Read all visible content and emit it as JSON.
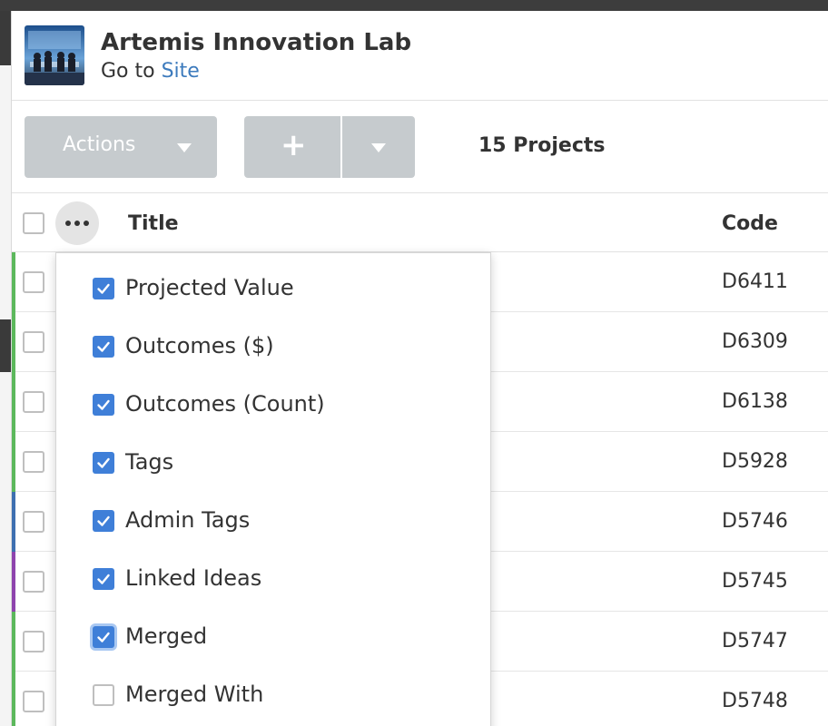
{
  "site": {
    "name": "Artemis Innovation Lab",
    "goto_prefix": "Go to",
    "goto_link": "Site"
  },
  "toolbar": {
    "actions_label": "Actions",
    "add_label": "+",
    "projects_count": "15 Projects"
  },
  "table": {
    "headers": {
      "title": "Title",
      "code": "Code"
    },
    "rows": [
      {
        "code": "D6411",
        "color": "#5cb85c"
      },
      {
        "code": "D6309",
        "color": "#5cb85c"
      },
      {
        "code": "D6138",
        "color": "#5cb85c"
      },
      {
        "code": "D5928",
        "color": "#5cb85c"
      },
      {
        "code": "D5746",
        "color": "#3e6fb0"
      },
      {
        "code": "D5745",
        "color": "#8e44ad"
      },
      {
        "code": "D5747",
        "color": "#5cb85c"
      },
      {
        "code": "D5748",
        "color": "#5cb85c"
      }
    ]
  },
  "column_menu": {
    "items": [
      {
        "label": "Projected Value",
        "checked": true
      },
      {
        "label": "Outcomes ($)",
        "checked": true
      },
      {
        "label": "Outcomes (Count)",
        "checked": true
      },
      {
        "label": "Tags",
        "checked": true
      },
      {
        "label": "Admin Tags",
        "checked": true
      },
      {
        "label": "Linked Ideas",
        "checked": true
      },
      {
        "label": "Merged",
        "checked": true,
        "focused": true
      },
      {
        "label": "Merged With",
        "checked": false
      }
    ]
  },
  "colors": {
    "accent": "#3f7fd8",
    "link": "#3d7bbd",
    "button": "#c6cbce"
  }
}
